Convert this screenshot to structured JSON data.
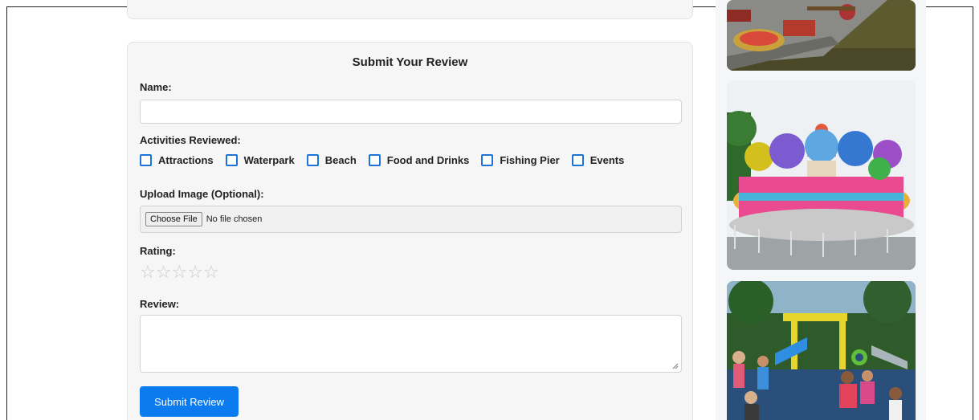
{
  "form": {
    "title": "Submit Your Review",
    "name_label": "Name:",
    "name_value": "",
    "activities_label": "Activities Reviewed:",
    "activities": [
      {
        "label": "Attractions",
        "checked": false
      },
      {
        "label": "Waterpark",
        "checked": false
      },
      {
        "label": "Beach",
        "checked": false
      },
      {
        "label": "Food and Drinks",
        "checked": false
      },
      {
        "label": "Fishing Pier",
        "checked": false
      },
      {
        "label": "Events",
        "checked": false
      }
    ],
    "upload_label": "Upload Image (Optional):",
    "choose_file": "Choose File",
    "file_status": "No file chosen",
    "rating_label": "Rating:",
    "rating": 0,
    "rating_max": 5,
    "star_glyph": "☆",
    "review_label": "Review:",
    "review_value": "",
    "submit_label": "Submit Review"
  },
  "colors": {
    "accent": "#0d7bf0",
    "checkbox": "#1e73d8",
    "star_empty": "#c9c9c9",
    "card_bg": "#f6f6f6"
  }
}
